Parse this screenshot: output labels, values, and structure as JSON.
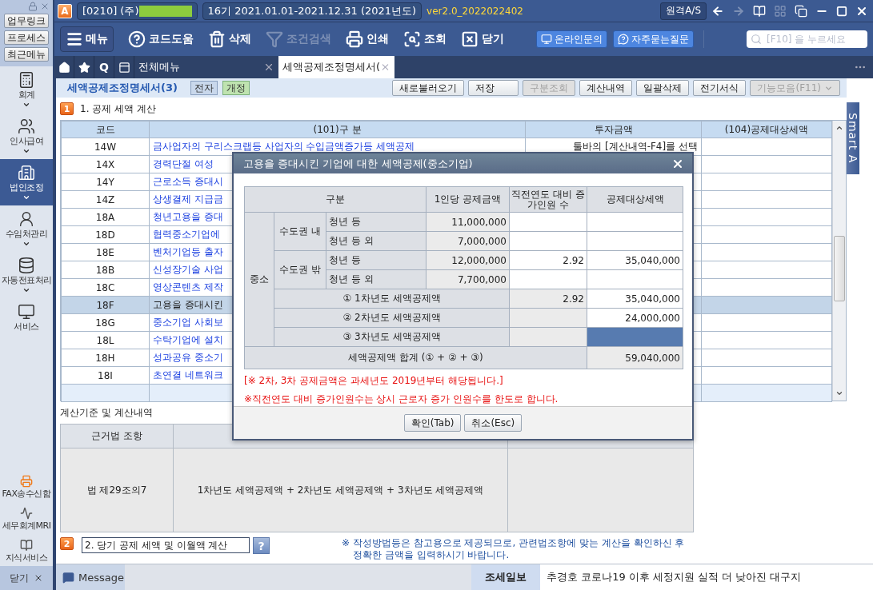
{
  "title_bar": {
    "logo": "A",
    "company": "[0210] (주)",
    "period": "16기  2021.01.01-2021.12.31  (2021년도)",
    "version": "ver2.0_2022022402",
    "remote_button": "원격A/S"
  },
  "sidebar": {
    "quick_buttons": [
      "업무링크",
      "프로세스",
      "최근메뉴"
    ],
    "items": [
      {
        "label": "회계",
        "selected": false,
        "dropdown": true
      },
      {
        "label": "인사급여",
        "selected": false,
        "dropdown": true
      },
      {
        "label": "법인조정",
        "selected": true,
        "dropdown": true
      },
      {
        "label": "수임처관리",
        "selected": false,
        "dropdown": true
      },
      {
        "label": "자동전표처리",
        "selected": false,
        "dropdown": true
      },
      {
        "label": "서비스",
        "selected": false,
        "dropdown": false
      }
    ],
    "bottom_items": [
      "FAX송수신함",
      "세무회계MRI",
      "지식서비스"
    ],
    "close_label": "닫기"
  },
  "toolbar": {
    "menu_label": "메뉴",
    "tools": [
      {
        "label": "코드도움",
        "disabled": false
      },
      {
        "label": "삭제",
        "disabled": false
      },
      {
        "label": "조건검색",
        "disabled": true
      },
      {
        "label": "인쇄",
        "disabled": false
      },
      {
        "label": "조회",
        "disabled": false
      },
      {
        "label": "닫기",
        "disabled": false
      }
    ],
    "links": [
      "온라인문의",
      "자주묻는질문"
    ],
    "search": {
      "placeholder": "[F10] 을 누르세요"
    }
  },
  "tabs": {
    "quick_label": "Q",
    "items": [
      {
        "label": "전체메뉴",
        "selected": false
      },
      {
        "label": "세액공제조정명세서(",
        "selected": true
      }
    ]
  },
  "page": {
    "title": "세액공제조정명세서(3)",
    "badges": [
      {
        "label": "전자",
        "kind": "plain"
      },
      {
        "label": "개정",
        "kind": "revised"
      }
    ],
    "buttons": [
      {
        "label": "새로불러오기",
        "disabled": false,
        "dropdown": false
      },
      {
        "label": "저장",
        "disabled": false,
        "dropdown": false
      },
      {
        "label": "구분조회",
        "disabled": true,
        "dropdown": false
      },
      {
        "label": "계산내역",
        "disabled": false,
        "dropdown": false
      },
      {
        "label": "일괄삭제",
        "disabled": false,
        "dropdown": false
      },
      {
        "label": "전기서식",
        "disabled": false,
        "dropdown": false
      },
      {
        "label": "기능모음(F11)",
        "disabled": true,
        "dropdown": true
      }
    ]
  },
  "section1": {
    "number": "1",
    "title": "1. 공제 세액 계산",
    "columns": [
      "코드",
      "(101)구 분",
      "투자금액",
      "(104)공제대상세액"
    ],
    "rows": [
      {
        "code": "14W",
        "name": "금사업자의 구리스크랩등 사업자의 수입금액증가등 세액공제",
        "amount": "툴바의 [계산내역-F4]를 선택",
        "selected": false
      },
      {
        "code": "14X",
        "name": "경력단절 여성",
        "selected": false
      },
      {
        "code": "14Y",
        "name": "근로소득 증대시",
        "selected": false
      },
      {
        "code": "14Z",
        "name": "상생결제 지급금",
        "selected": false
      },
      {
        "code": "18A",
        "name": "청년고용을 증대",
        "selected": false
      },
      {
        "code": "18D",
        "name": "협력중소기업에",
        "selected": false
      },
      {
        "code": "18E",
        "name": "벤처기업등 출자",
        "selected": false
      },
      {
        "code": "18B",
        "name": "신성장기술 사업",
        "selected": false
      },
      {
        "code": "18C",
        "name": "영상콘텐츠 제작",
        "selected": false
      },
      {
        "code": "18F",
        "name": "고용을 증대시킨",
        "selected": true
      },
      {
        "code": "18G",
        "name": "중소기업 사회보",
        "selected": false
      },
      {
        "code": "18L",
        "name": "수탁기업에 설치",
        "selected": false
      },
      {
        "code": "18H",
        "name": "성과공유 중소기",
        "selected": false
      },
      {
        "code": "18I",
        "name": "초연결 네트워크",
        "selected": false
      }
    ]
  },
  "calc": {
    "title": "계산기준 및 계산내역",
    "column_1": "근거법 조항",
    "law": "법 제29조의7",
    "basis": "1차년도 세액공제액 + 2차년도 세액공제액 + 3차년도 세액공제액"
  },
  "section2": {
    "number": "2",
    "value": "2. 당기 공제 세액 및 이월액 계산",
    "help_label": "?",
    "note": [
      "※ 작성방법등은 참고용으로 제공되므로, 관련법조항에 맞는 계산을 확인하신 후",
      "정확한 금액을 입력하시기 바랍니다."
    ]
  },
  "smart_tab": "Smart A",
  "bottom_bar": {
    "message_tab": "Message",
    "news_source": "조세일보",
    "headline": "추경호 코로나19 이후 세정지원 실적 더 낮아진 대구지"
  },
  "dialog": {
    "title": "고용을 증대시킨 기업에 대한 세액공제(중소기업)",
    "columns": [
      "구분",
      "1인당 공제금액",
      "직전연도 대비 증가인원 수",
      "공제대상세액"
    ],
    "group": "중소",
    "regions": [
      {
        "label": "수도권 내",
        "rows": [
          {
            "label": "청년 등",
            "per_person": "11,000,000"
          },
          {
            "label": "청년 등 외",
            "per_person": "7,000,000"
          }
        ]
      },
      {
        "label": "수도권 밖",
        "rows": [
          {
            "label": "청년 등",
            "per_person": "12,000,000",
            "increase": "2.92",
            "target": "35,040,000"
          },
          {
            "label": "청년 등 외",
            "per_person": "7,700,000"
          }
        ]
      }
    ],
    "year_rows": [
      {
        "label": "① 1차년도 세액공제액",
        "increase": "2.92",
        "target": "35,040,000",
        "selected": false
      },
      {
        "label": "② 2차년도 세액공제액",
        "target": "24,000,000",
        "selected": false
      },
      {
        "label": "③ 3차년도 세액공제액",
        "selected": true
      }
    ],
    "total": {
      "label": "세액공제액 합계 (① + ② + ③)",
      "target": "59,040,000"
    },
    "notes": [
      "[※ 2차, 3차 공제금액은 과세년도 2019년부터 해당됩니다.]",
      "※직전연도 대비 증가인원수는 상시 근로자 증가 인원수를 한도로 합니다."
    ],
    "buttons": [
      "확인(Tab)",
      "취소(Esc)"
    ]
  }
}
